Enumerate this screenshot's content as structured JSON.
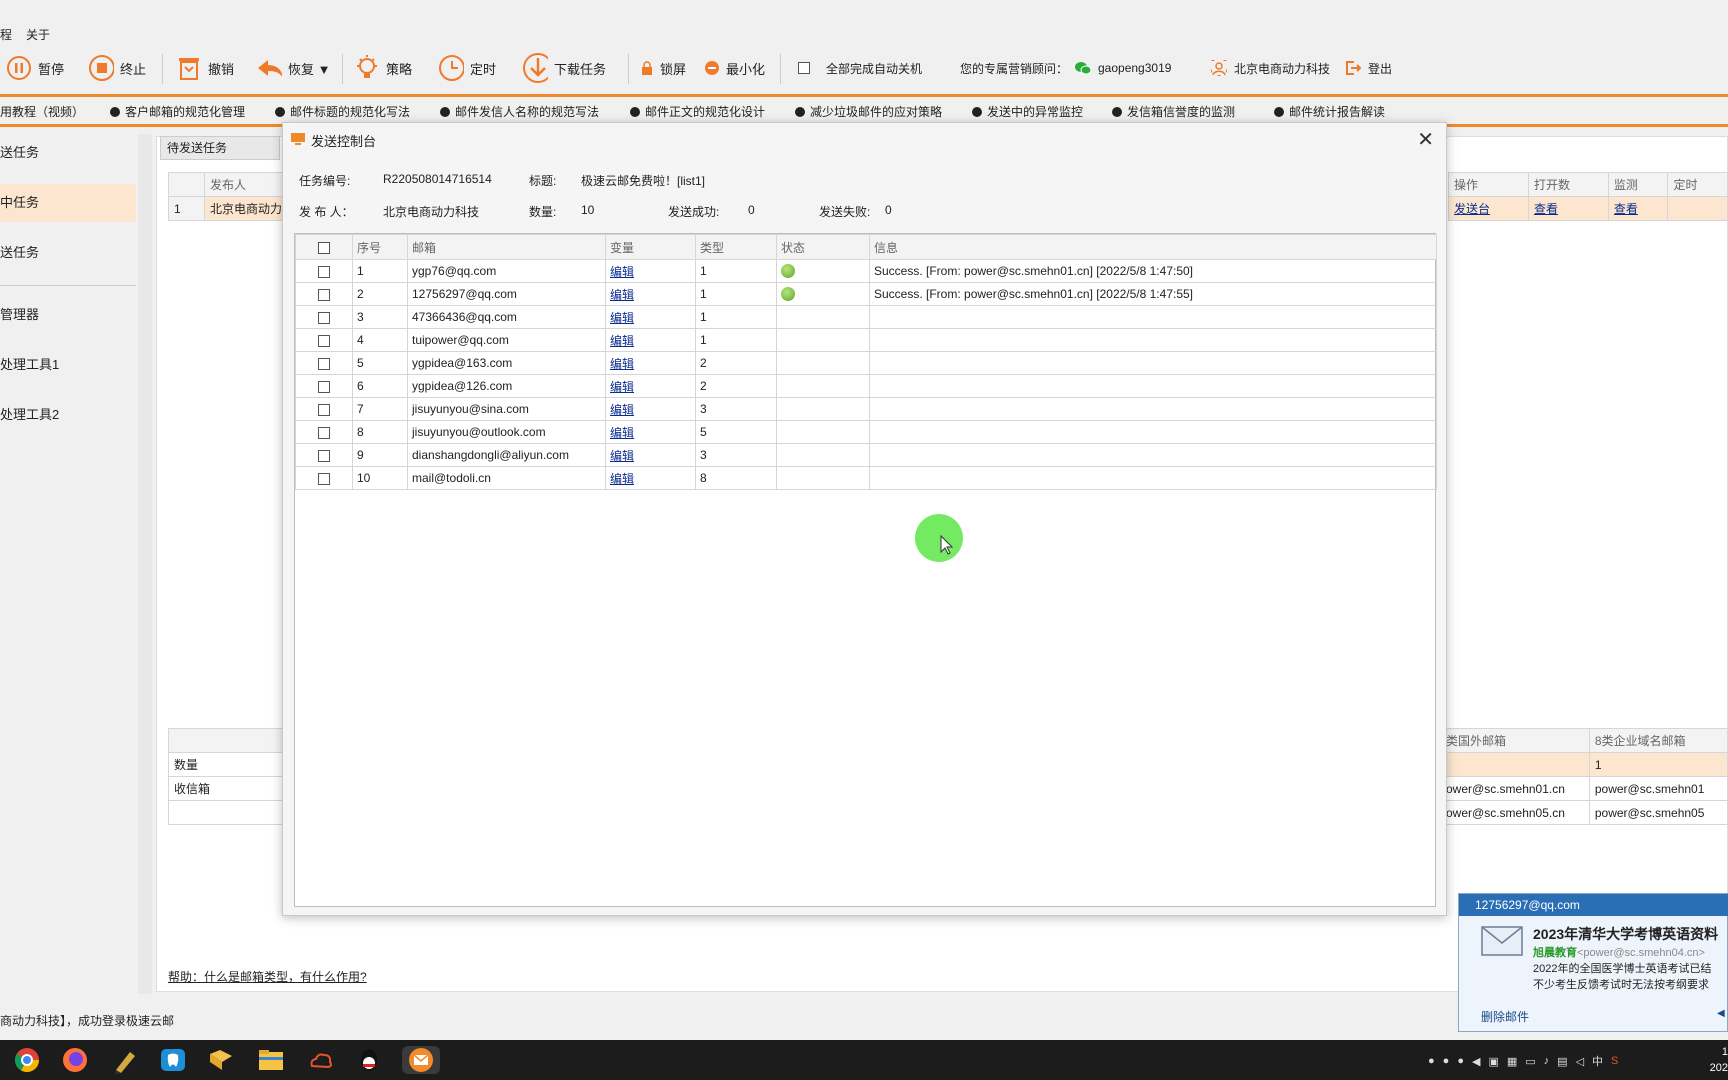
{
  "menu": {
    "item1": "程",
    "item2": "关于"
  },
  "toolbar": {
    "pause": "暂停",
    "stop": "终止",
    "undo": "撤销",
    "restore": "恢复 ▼",
    "strategy": "策略",
    "timer": "定时",
    "download": "下载任务",
    "lock": "锁屏",
    "minimize": "最小化",
    "auto_shutdown": "全部完成自动关机",
    "advisor_label": "您的专属营销顾问：",
    "advisor_wechat": "gaopeng3019",
    "company": "北京电商动力科技",
    "logout": "登出"
  },
  "tutorials": [
    "用教程（视频）",
    "客户邮箱的规范化管理",
    "邮件标题的规范化写法",
    "邮件发信人名称的规范写法",
    "邮件正文的规范化设计",
    "减少垃圾邮件的应对策略",
    "发送中的异常监控",
    "发信箱信誉度的监测",
    "邮件统计报告解读"
  ],
  "sidebar": [
    "送任务",
    "中任务",
    "送任务",
    "管理器",
    "处理工具1",
    "处理工具2"
  ],
  "bg": {
    "tab": "待发送任务",
    "top_headers": [
      "发布人"
    ],
    "top_row": {
      "index": "1",
      "publisher": "北京电商动力"
    },
    "right_headers": [
      "操作",
      "打开数",
      "监测",
      "定时"
    ],
    "right_row": [
      "发送台",
      "查看",
      "查看",
      ""
    ],
    "bottom_left": [
      "数量",
      "收信箱"
    ],
    "bottom_right_headers": [
      "类国外邮箱",
      "8类企业域名邮箱"
    ],
    "bottom_right_rows": [
      [
        "",
        "1"
      ],
      [
        "ower@sc.smehn01.cn",
        "power@sc.smehn01"
      ],
      [
        "ower@sc.smehn05.cn",
        "power@sc.smehn05"
      ]
    ],
    "help": "帮助：什么是邮箱类型，有什么作用?"
  },
  "dialog": {
    "title": "发送控制台",
    "task_no_label": "任务编号:",
    "task_no": "R220508014716514",
    "subject_label": "标题:",
    "subject": "极速云邮免费啦！[list1]",
    "publisher_label": "发 布 人：",
    "publisher": "北京电商动力科技",
    "count_label": "数量:",
    "count": "10",
    "success_label": "发送成功:",
    "success": "0",
    "fail_label": "发送失败:",
    "fail": "0",
    "headers": [
      "序号",
      "邮箱",
      "变量",
      "类型",
      "状态",
      "信息"
    ],
    "rows": [
      {
        "no": "1",
        "email": "ygp76@qq.com",
        "var": "编辑",
        "type": "1",
        "ok": true,
        "info": "Success. [From: power@sc.smehn01.cn] [2022/5/8 1:47:50]"
      },
      {
        "no": "2",
        "email": "12756297@qq.com",
        "var": "编辑",
        "type": "1",
        "ok": true,
        "info": "Success. [From: power@sc.smehn01.cn] [2022/5/8 1:47:55]"
      },
      {
        "no": "3",
        "email": "47366436@qq.com",
        "var": "编辑",
        "type": "1",
        "ok": false,
        "info": ""
      },
      {
        "no": "4",
        "email": "tuipower@qq.com",
        "var": "编辑",
        "type": "1",
        "ok": false,
        "info": ""
      },
      {
        "no": "5",
        "email": "ygpidea@163.com",
        "var": "编辑",
        "type": "2",
        "ok": false,
        "info": ""
      },
      {
        "no": "6",
        "email": "ygpidea@126.com",
        "var": "编辑",
        "type": "2",
        "ok": false,
        "info": ""
      },
      {
        "no": "7",
        "email": "jisuyunyou@sina.com",
        "var": "编辑",
        "type": "3",
        "ok": false,
        "info": ""
      },
      {
        "no": "8",
        "email": "jisuyunyou@outlook.com",
        "var": "编辑",
        "type": "5",
        "ok": false,
        "info": ""
      },
      {
        "no": "9",
        "email": "dianshangdongli@aliyun.com",
        "var": "编辑",
        "type": "3",
        "ok": false,
        "info": ""
      },
      {
        "no": "10",
        "email": "mail@todoli.cn",
        "var": "编辑",
        "type": "8",
        "ok": false,
        "info": ""
      }
    ]
  },
  "status": "商动力科技】，成功登录极速云邮",
  "notification": {
    "account": "12756297@qq.com",
    "subject": "2023年清华大学考博英语资料",
    "sender": "旭晨教育",
    "sender_email": "<power@sc.smehn04.cn>",
    "line1": "2022年的全国医学博士英语考试已结",
    "line2": "不少考生反馈考试时无法按考纲要求",
    "delete": "删除邮件"
  },
  "clock": {
    "time": "1",
    "date": "202"
  },
  "colors": {
    "accent": "#ef8a2a",
    "highlight": "#fde6cf",
    "link": "#0a2c8f"
  }
}
